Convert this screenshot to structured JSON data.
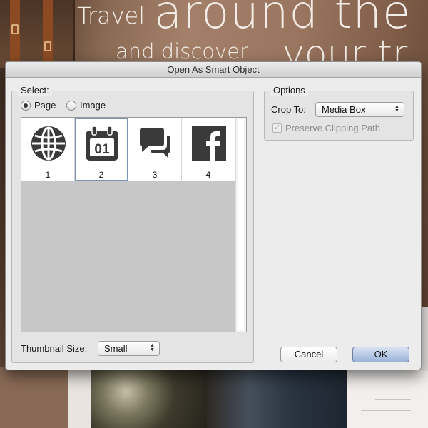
{
  "background": {
    "line1_small": "Travel",
    "line1_big": "around the w",
    "line2_small": "and discover",
    "line2_big": "your tr"
  },
  "dialog": {
    "title": "Open As Smart Object",
    "select": {
      "legend": "Select:",
      "radio_page": "Page",
      "radio_image": "Image",
      "selected": "Page",
      "thumbnails": [
        {
          "number": "1",
          "icon": "globe-icon"
        },
        {
          "number": "2",
          "icon": "calendar-icon"
        },
        {
          "number": "3",
          "icon": "chat-bubbles-icon"
        },
        {
          "number": "4",
          "icon": "facebook-icon"
        }
      ],
      "selected_thumbnail": "2",
      "thumbnail_size_label": "Thumbnail Size:",
      "thumbnail_size_value": "Small"
    },
    "options": {
      "legend": "Options",
      "crop_to_label": "Crop To:",
      "crop_to_value": "Media Box",
      "preserve_clipping_label": "Preserve Clipping Path",
      "preserve_clipping_checked": true,
      "preserve_clipping_enabled": false
    },
    "buttons": {
      "cancel": "Cancel",
      "ok": "OK"
    }
  },
  "colors": {
    "dialog_bg": "#ececec",
    "selection_outline": "#7d93b8",
    "default_button": "#9cb3d8",
    "icon_color": "#3a3a3a"
  }
}
